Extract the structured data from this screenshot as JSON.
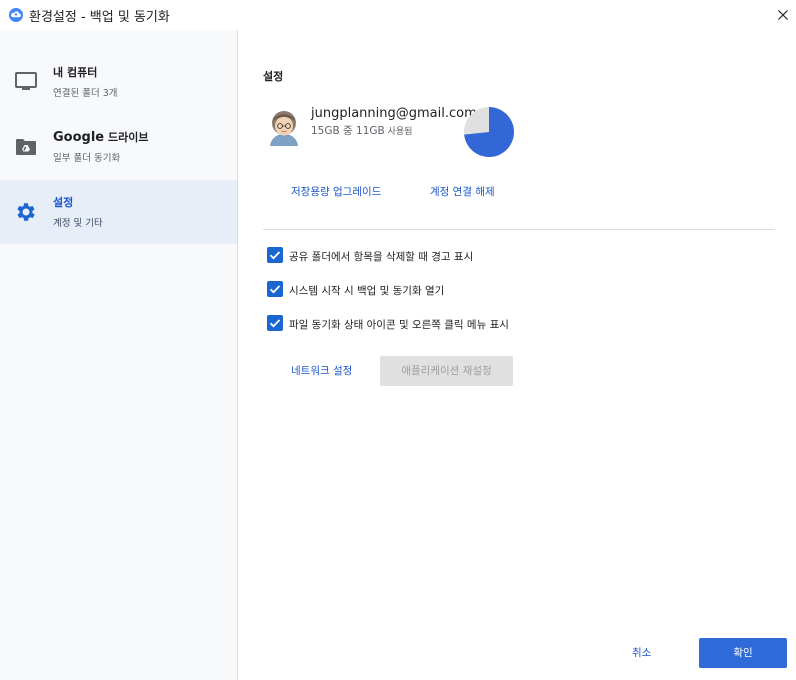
{
  "window": {
    "title": "환경설정 - 백업 및 동기화",
    "icon": "backup-sync-cloud-icon",
    "close_icon": "close-icon"
  },
  "sidebar": {
    "items": [
      {
        "title": "내 컴퓨터",
        "subtitle": "연결된 폴더 3개",
        "icon": "monitor-icon",
        "active": false
      },
      {
        "title_bold": "Google",
        "title_rest": " 드라이브",
        "subtitle": "일부 폴더 동기화",
        "icon": "drive-folder-icon",
        "active": false
      },
      {
        "title": "설정",
        "subtitle": "계정 및 기타",
        "icon": "gear-icon",
        "active": true
      }
    ]
  },
  "settings": {
    "heading": "설정",
    "account": {
      "email": "jungplanning@gmail.com",
      "usage_main": "15GB 중 11GB",
      "usage_suffix": " 사용됨",
      "used_fraction": 0.733
    },
    "upgrade_link": "저장용량 업그레이드",
    "disconnect_link": "계정 연결 해제",
    "options": [
      {
        "label": "공유 폴더에서 항목을 삭제할 때 경고 표시",
        "checked": true
      },
      {
        "label": "시스템 시작 시 백업 및 동기화 열기",
        "checked": true
      },
      {
        "label": "파일 동기화 상태 아이콘 및 오른쪽 클릭 메뉴 표시",
        "checked": true
      }
    ],
    "network_link": "네트워크 설정",
    "reset_button": "애플리케이션 재설정"
  },
  "footer": {
    "cancel": "취소",
    "ok": "확인"
  },
  "colors": {
    "accent": "#1a56c9",
    "primary_button": "#2f6ad9",
    "pie_used": "#3367d6",
    "pie_free": "#e0e0e0",
    "sidebar_active_bg": "#e8eef8"
  }
}
